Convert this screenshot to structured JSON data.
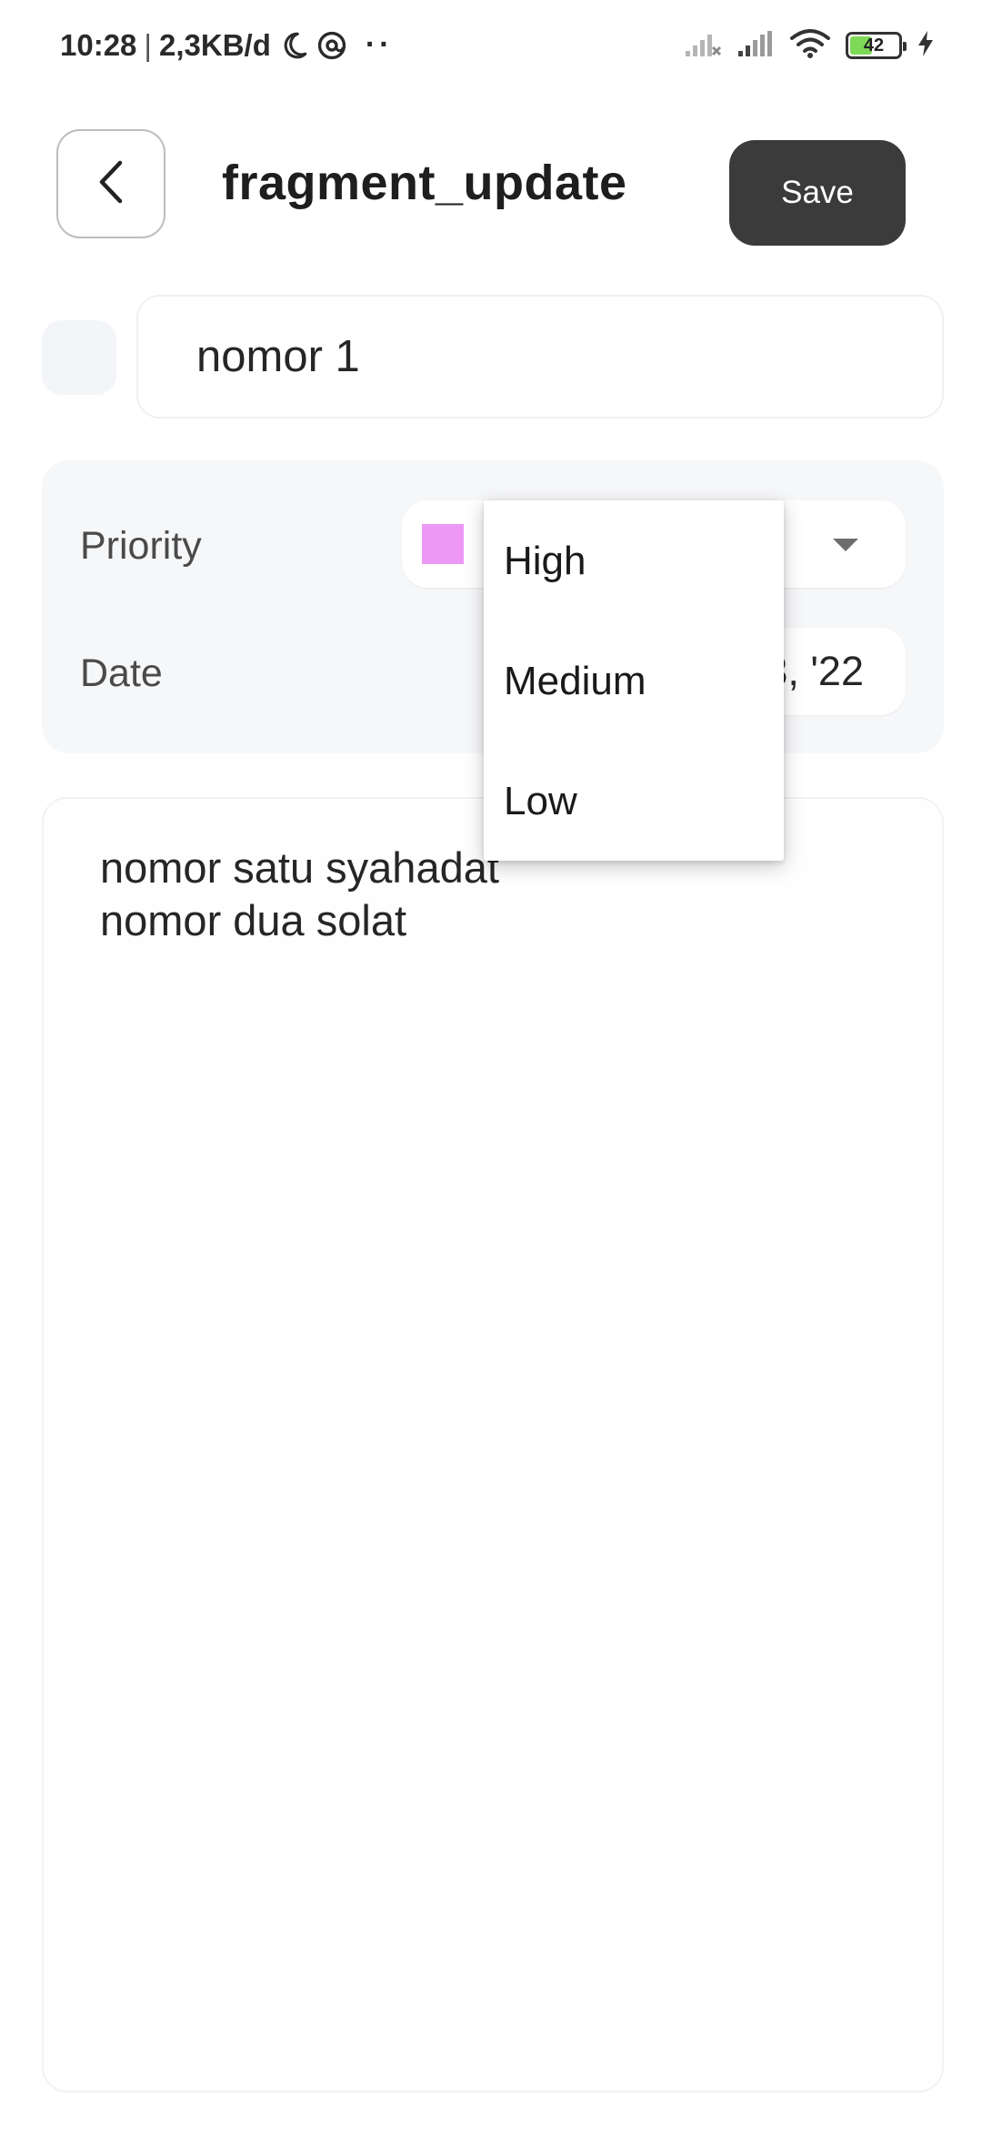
{
  "status_bar": {
    "time": "10:28",
    "separator": "|",
    "network_speed": "2,3KB/d",
    "more": "··",
    "battery_level": "42",
    "icons": [
      "moon-icon",
      "at-sign-icon",
      "signal-off-icon",
      "signal-icon",
      "wifi-icon",
      "battery-icon",
      "charging-bolt-icon"
    ]
  },
  "header": {
    "title": "fragment_update",
    "save_label": "Save",
    "back_icon": "chevron-left-icon"
  },
  "form": {
    "title_value": "nomor 1",
    "priority_label": "Priority",
    "priority_color": "#ee98f6",
    "date_label": "Date",
    "date_value": "3, '22",
    "description_lines": [
      "nomor satu syahadat",
      "nomor dua solat"
    ]
  },
  "dropdown": {
    "options": [
      "High",
      "Medium",
      "Low"
    ]
  },
  "colors": {
    "save_button": "#3b3b3b",
    "card_background": "#f6f7f9",
    "battery_fill": "#7ed957"
  }
}
